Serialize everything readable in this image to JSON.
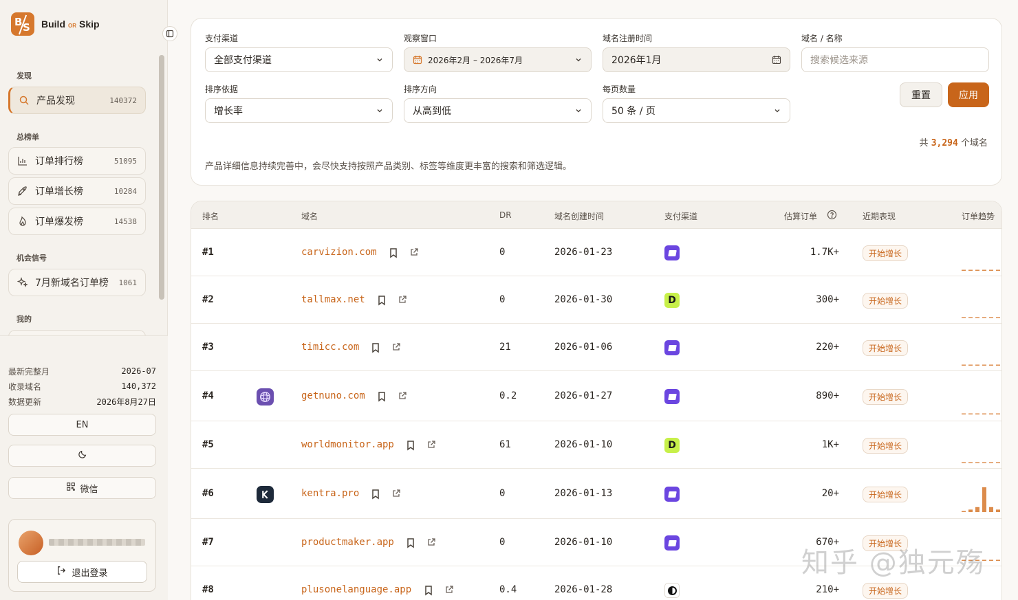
{
  "brand": {
    "name_left": "Build",
    "name_or": "OR",
    "name_right": "Skip",
    "logo_letters": [
      "B",
      "S"
    ],
    "accent": "#d6782d"
  },
  "sidebar": {
    "section_discover": "发现",
    "discover_item": {
      "label": "产品发现",
      "count": "140372",
      "icon": "search-icon"
    },
    "section_boards": "总榜单",
    "boards": [
      {
        "label": "订单排行榜",
        "count": "51095",
        "icon": "bar-chart-icon"
      },
      {
        "label": "订单增长榜",
        "count": "10284",
        "icon": "rocket-icon"
      },
      {
        "label": "订单爆发榜",
        "count": "14538",
        "icon": "flame-icon"
      }
    ],
    "section_signals": "机会信号",
    "signal_item": {
      "label": "7月新域名订单榜",
      "count": "1061",
      "icon": "sparkles-icon"
    },
    "section_mine": "我的",
    "stats": [
      {
        "key": "最新完整月",
        "value": "2026-07"
      },
      {
        "key": "收录域名",
        "value": "140,372"
      },
      {
        "key": "数据更新",
        "value": "2026年8月27日"
      }
    ],
    "lang_button": "EN",
    "theme_icon": "moon-icon",
    "wechat_button": "微信",
    "logout_button": "退出登录"
  },
  "filters": {
    "payment_label": "支付渠道",
    "payment_value": "全部支付渠道",
    "window_label": "观察窗口",
    "window_value": "2026年2月 – 2026年7月",
    "reg_label": "域名注册时间",
    "reg_value": "2026年1月",
    "search_label": "域名 / 名称",
    "search_placeholder": "搜索候选来源",
    "sort_label": "排序依据",
    "sort_value": "增长率",
    "dir_label": "排序方向",
    "dir_value": "从高到低",
    "per_page_label": "每页数量",
    "per_page_value": "50 条 / 页",
    "reset_button": "重置",
    "apply_button": "应用",
    "total_prefix": "共",
    "total_count": "3,294",
    "total_suffix": "个域名",
    "notice": "产品详细信息持续完善中，会尽快支持按照产品类别、标签等维度更丰富的搜索和筛选逻辑。"
  },
  "table": {
    "headers": {
      "rank": "排名",
      "domain": "域名",
      "dr": "DR",
      "created": "域名创建时间",
      "payment": "支付渠道",
      "orders": "估算订单",
      "recent": "近期表现",
      "trend": "订单趋势"
    },
    "rows": [
      {
        "rank": "#1",
        "domain": "carvizion.com",
        "dr": "0",
        "created": "2026-01-23",
        "payment": "stripe",
        "orders": "1.7K+",
        "recent": "开始增长",
        "logo": "",
        "spark": [
          0,
          0,
          0,
          0,
          0,
          0
        ]
      },
      {
        "rank": "#2",
        "domain": "tallmax.net",
        "dr": "0",
        "created": "2026-01-30",
        "payment": "D",
        "orders": "300+",
        "recent": "开始增长",
        "logo": "",
        "spark": [
          0,
          0,
          0,
          0,
          0,
          0
        ]
      },
      {
        "rank": "#3",
        "domain": "timicc.com",
        "dr": "21",
        "created": "2026-01-06",
        "payment": "stripe",
        "orders": "220+",
        "recent": "开始增长",
        "logo": "",
        "spark": [
          0,
          0,
          0,
          0,
          0,
          0
        ]
      },
      {
        "rank": "#4",
        "domain": "getnuno.com",
        "dr": "0.2",
        "created": "2026-01-27",
        "payment": "stripe",
        "orders": "890+",
        "recent": "开始增长",
        "logo": "purple-knot-logo",
        "spark": [
          0,
          0,
          0,
          0,
          0,
          0
        ]
      },
      {
        "rank": "#5",
        "domain": "worldmonitor.app",
        "dr": "61",
        "created": "2026-01-10",
        "payment": "D",
        "orders": "1K+",
        "recent": "开始增长",
        "logo": "",
        "spark": [
          0,
          0,
          0,
          0,
          0,
          0
        ]
      },
      {
        "rank": "#6",
        "domain": "kentra.pro",
        "dr": "0",
        "created": "2026-01-13",
        "payment": "stripe",
        "orders": "20+",
        "recent": "开始增长",
        "logo": "dark-k-logo",
        "spark": [
          0,
          0.1,
          0.2,
          1,
          0.2,
          0.1
        ]
      },
      {
        "rank": "#7",
        "domain": "productmaker.app",
        "dr": "0",
        "created": "2026-01-10",
        "payment": "stripe",
        "orders": "670+",
        "recent": "开始增长",
        "logo": "",
        "spark": [
          0,
          0,
          0,
          0,
          0,
          0
        ]
      },
      {
        "rank": "#8",
        "domain": "plusonelanguage.app",
        "dr": "0.4",
        "created": "2026-01-28",
        "payment": "half",
        "orders": "210+",
        "recent": "开始增长",
        "logo": "",
        "spark": [
          0,
          0,
          0,
          0,
          0,
          0
        ]
      }
    ]
  },
  "watermark": "知乎 @独元殇"
}
